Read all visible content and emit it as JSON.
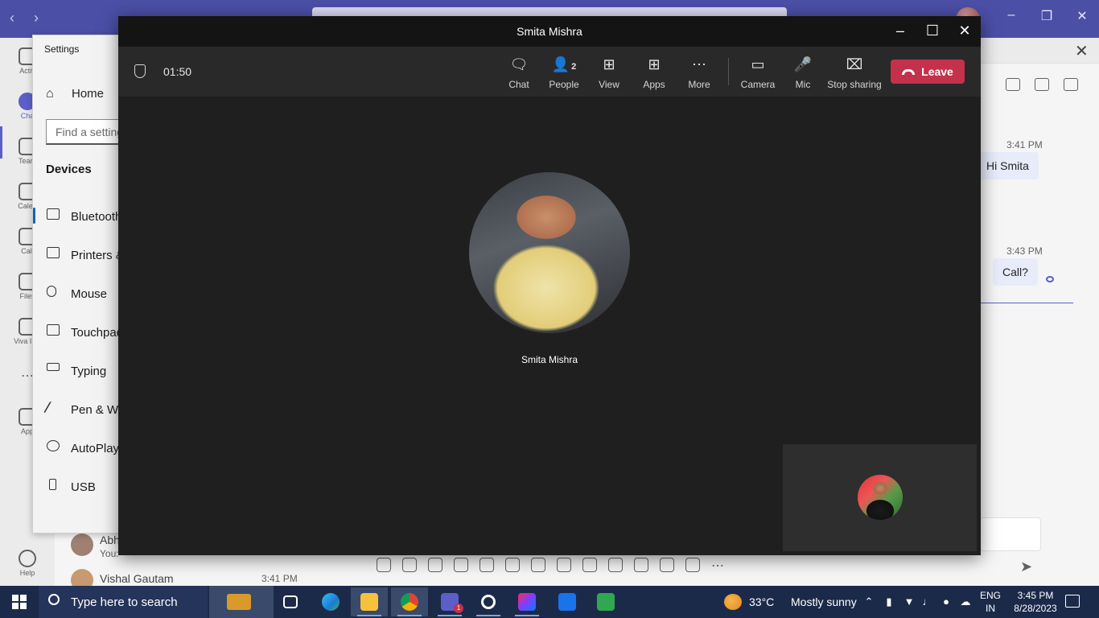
{
  "call": {
    "title": "Smita Mishra",
    "timer": "01:50",
    "toolbar": {
      "chat": "Chat",
      "people": "People",
      "people_count": "2",
      "view": "View",
      "apps": "Apps",
      "more": "More",
      "camera": "Camera",
      "mic": "Mic",
      "stop_sharing": "Stop sharing",
      "leave": "Leave"
    },
    "participant_name": "Smita Mishra"
  },
  "settings": {
    "title": "Settings",
    "home": "Home",
    "search_placeholder": "Find a setting",
    "section": "Devices",
    "items": [
      {
        "label": "Bluetooth",
        "icon": "bluetooth-devices-icon"
      },
      {
        "label": "Printers &",
        "icon": "printer-icon"
      },
      {
        "label": "Mouse",
        "icon": "mouse-icon"
      },
      {
        "label": "Touchpad",
        "icon": "touchpad-icon"
      },
      {
        "label": "Typing",
        "icon": "keyboard-icon"
      },
      {
        "label": "Pen & Wir",
        "icon": "pen-icon"
      },
      {
        "label": "AutoPlay",
        "icon": "autoplay-icon"
      },
      {
        "label": "USB",
        "icon": "usb-icon"
      }
    ]
  },
  "teams": {
    "rail": [
      {
        "label": "Activ"
      },
      {
        "label": "Cha"
      },
      {
        "label": "Team"
      },
      {
        "label": "Calen"
      },
      {
        "label": "Call"
      },
      {
        "label": "Files"
      },
      {
        "label": "Viva Insi"
      },
      {
        "label": "App"
      },
      {
        "label": "Help"
      }
    ],
    "chats": [
      {
        "name": "Abh",
        "sub": "You:",
        "time": ""
      },
      {
        "name": "Vishal Gautam",
        "sub": "",
        "time": "3:41 PM"
      }
    ],
    "messages": [
      {
        "time": "3:41 PM",
        "text": "Hi Smita"
      },
      {
        "time": "3:43 PM",
        "text": "Call?"
      }
    ]
  },
  "taskbar": {
    "search_placeholder": "Type here to search",
    "weather_temp": "33°C",
    "weather_cond": "Mostly sunny",
    "lang_top": "ENG",
    "lang_bottom": "IN",
    "time": "3:45 PM",
    "date": "8/28/2023",
    "teams_badge": "1"
  },
  "colors": {
    "leave": "#c4314b",
    "teams_brand": "#4b4fa6",
    "call_bg": "#1f1f1f"
  }
}
